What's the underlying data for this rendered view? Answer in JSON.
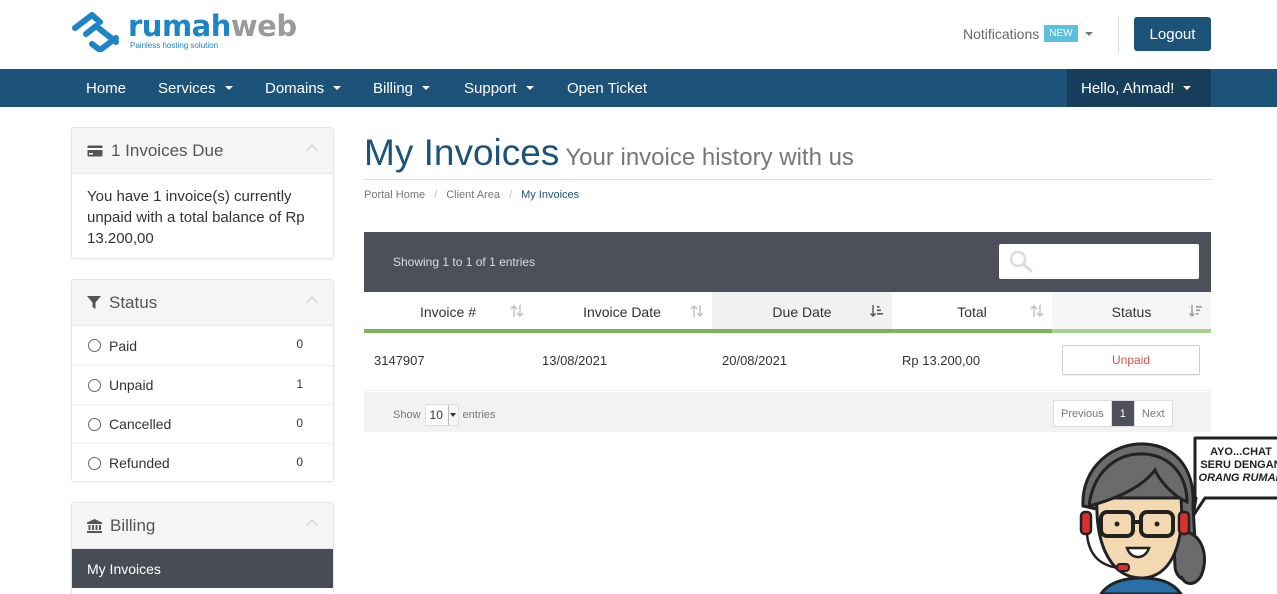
{
  "brand": {
    "name_part1": "rumah",
    "name_part2": "web",
    "tagline": "Painless hosting solution",
    "primary_color": "#1d84c6",
    "nav_color": "#1d5379"
  },
  "header": {
    "notifications_label": "Notifications",
    "notifications_badge": "NEW",
    "logout_label": "Logout"
  },
  "nav": {
    "items": [
      {
        "label": "Home",
        "dropdown": false
      },
      {
        "label": "Services",
        "dropdown": true
      },
      {
        "label": "Domains",
        "dropdown": true
      },
      {
        "label": "Billing",
        "dropdown": true
      },
      {
        "label": "Support",
        "dropdown": true
      },
      {
        "label": "Open Ticket",
        "dropdown": false
      }
    ],
    "user_label": "Hello, Ahmad!"
  },
  "sidebar": {
    "invoices_due": {
      "title": "1 Invoices Due",
      "body": "You have 1 invoice(s) currently unpaid with a total balance of Rp 13.200,00"
    },
    "status": {
      "title": "Status",
      "items": [
        {
          "label": "Paid",
          "count": "0"
        },
        {
          "label": "Unpaid",
          "count": "1"
        },
        {
          "label": "Cancelled",
          "count": "0"
        },
        {
          "label": "Refunded",
          "count": "0"
        }
      ]
    },
    "billing": {
      "title": "Billing",
      "active_item": "My Invoices"
    }
  },
  "page": {
    "title": "My Invoices",
    "subtitle": "Your invoice history with us",
    "breadcrumb": [
      "Portal Home",
      "Client Area",
      "My Invoices"
    ]
  },
  "table": {
    "info": "Showing 1 to 1 of 1 entries",
    "search_value": "",
    "columns": [
      "Invoice #",
      "Invoice Date",
      "Due Date",
      "Total",
      "Status"
    ],
    "rows": [
      {
        "invoice": "3147907",
        "invoice_date": "13/08/2021",
        "due_date": "20/08/2021",
        "total": "Rp 13.200,00",
        "status": "Unpaid"
      }
    ],
    "footer": {
      "show_label": "Show",
      "page_length": "10",
      "entries_label": "entries",
      "prev_label": "Previous",
      "current_page": "1",
      "next_label": "Next"
    }
  },
  "chat_widget": {
    "line1": "AYO...CHAT",
    "line2": "SERU DENGAN",
    "line3": "ORANG RUMAH"
  }
}
